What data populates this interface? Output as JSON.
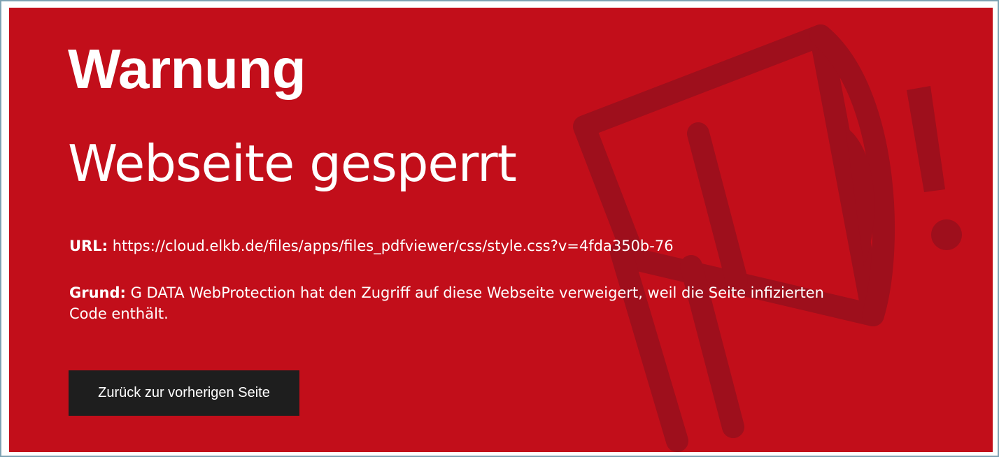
{
  "colors": {
    "panel_background": "#c20e1a",
    "watermark": "#9e0f1c",
    "button_background": "#1e1e1e",
    "text": "#ffffff"
  },
  "watermark": {
    "icon": "megaphone-exclamation-icon"
  },
  "header": {
    "title": "Warnung",
    "subtitle": "Webseite gesperrt"
  },
  "details": {
    "url_label": "URL:",
    "url_value": " https://cloud.elkb.de/files/apps/files_pdfviewer/css/style.css?v=4fda350b-76",
    "reason_label": "Grund:",
    "reason_value": " G DATA WebProtection hat den Zugriff auf diese Webseite verweigert, weil die Seite infizierten Code enthält."
  },
  "actions": {
    "back_label": "Zurück zur vorherigen Seite"
  }
}
